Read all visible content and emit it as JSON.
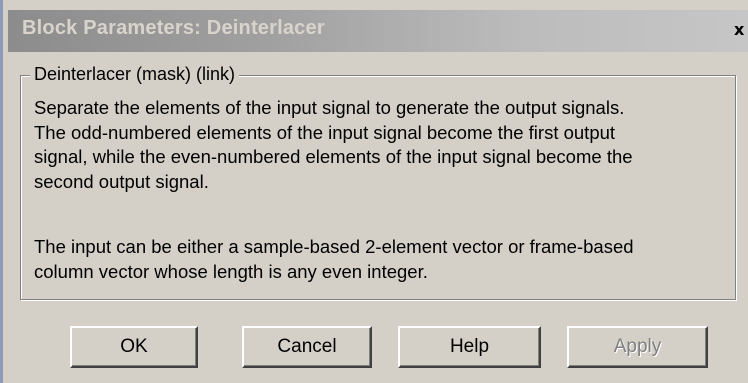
{
  "window": {
    "title": "Block Parameters: Deinterlacer",
    "close_glyph": "x"
  },
  "group": {
    "legend": "Deinterlacer (mask) (link)",
    "description_lines": [
      "Separate the elements of the input signal to generate the output signals.",
      "The odd-numbered elements of the input signal become the first output",
      "signal, while the even-numbered elements of the input signal become the",
      "second output signal."
    ],
    "note_lines": [
      "The input can be either a sample-based 2-element vector or frame-based",
      "column vector whose length is any even integer."
    ]
  },
  "buttons": {
    "ok": "OK",
    "cancel": "Cancel",
    "help": "Help",
    "apply": "Apply",
    "apply_enabled": false
  },
  "colors": {
    "dialog_background": "#d4d0c8",
    "title_gradient_start": "#8c8c8c",
    "title_gradient_end": "#c6c6c6",
    "disabled_text": "#808080"
  },
  "icons": {
    "close": "close-icon"
  }
}
